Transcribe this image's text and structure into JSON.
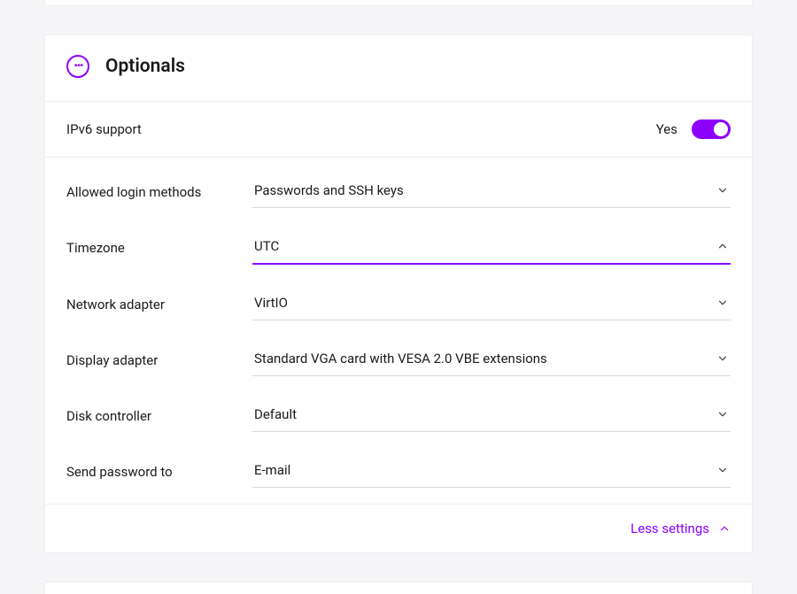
{
  "section": {
    "title": "Optionals"
  },
  "toggle": {
    "label": "IPv6 support",
    "state_label": "Yes",
    "on": true
  },
  "fields": [
    {
      "label": "Allowed login methods",
      "value": "Passwords and SSH keys",
      "open": false,
      "name": "login-methods"
    },
    {
      "label": "Timezone",
      "value": "UTC",
      "open": true,
      "name": "timezone"
    },
    {
      "label": "Network adapter",
      "value": "VirtIO",
      "open": false,
      "name": "network-adapter"
    },
    {
      "label": "Display adapter",
      "value": "Standard VGA card with VESA 2.0 VBE extensions",
      "open": false,
      "name": "display-adapter"
    },
    {
      "label": "Disk controller",
      "value": "Default",
      "open": false,
      "name": "disk-controller"
    },
    {
      "label": "Send password to",
      "value": "E-mail",
      "open": false,
      "name": "send-password-to"
    }
  ],
  "footer": {
    "label": "Less settings"
  },
  "colors": {
    "accent": "#8c00ff"
  }
}
